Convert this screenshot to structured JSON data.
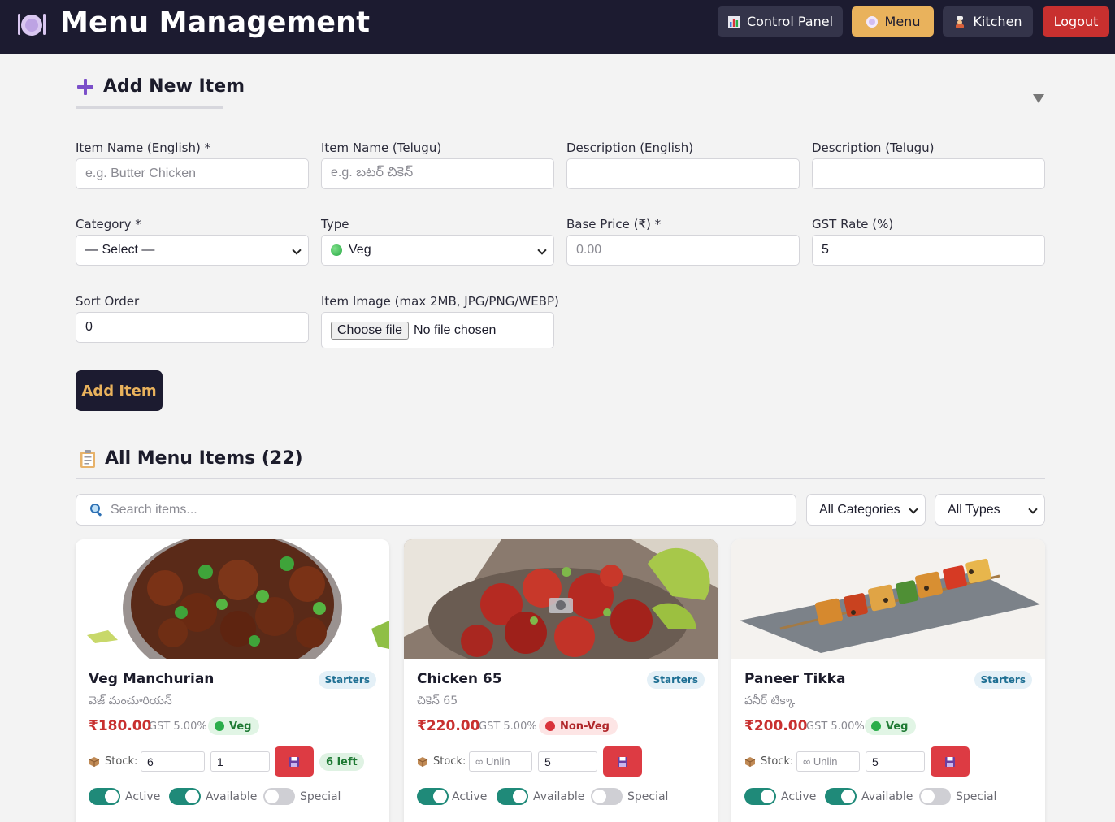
{
  "header": {
    "title": "Menu Management",
    "icon": "plate-cutlery-icon",
    "nav": {
      "control_panel": "Control Panel",
      "menu": "Menu",
      "kitchen": "Kitchen",
      "logout": "Logout"
    },
    "colors": {
      "bar": "#1c1b30",
      "active_nav": "#e9b25c",
      "logout": "#c8302f"
    }
  },
  "add_form": {
    "title": "Add New Item",
    "fields": {
      "name_en": {
        "label": "Item Name (English) *",
        "placeholder": "e.g. Butter Chicken"
      },
      "name_te": {
        "label": "Item Name (Telugu)",
        "placeholder": "e.g. బటర్ చికెన్"
      },
      "desc_en": {
        "label": "Description (English)",
        "value": ""
      },
      "desc_te": {
        "label": "Description (Telugu)",
        "value": ""
      },
      "category": {
        "label": "Category *",
        "value": "— Select —"
      },
      "type": {
        "label": "Type",
        "value": "Veg"
      },
      "base_price": {
        "label": "Base Price (₹) *",
        "placeholder": "0.00"
      },
      "gst_rate": {
        "label": "GST Rate (%)",
        "value": "5"
      },
      "sort_order": {
        "label": "Sort Order",
        "value": "0"
      },
      "image": {
        "label": "Item Image (max 2MB, JPG/PNG/WEBP)",
        "button": "Choose file",
        "status": "No file chosen"
      }
    },
    "submit": "Add Item"
  },
  "list": {
    "title": "All Menu Items (22)",
    "search_placeholder": "Search items...",
    "filter_category": "All Categories",
    "filter_type": "All Types",
    "items": [
      {
        "name": "Veg Manchurian",
        "name_te": "వెజ్ మంచూరియన్",
        "category": "Starters",
        "price": "₹180.00",
        "gst": "GST 5.00%",
        "type": "Veg",
        "stock_label": "Stock:",
        "stock_value": "6",
        "stock_step": "1",
        "stock_left": "6 left",
        "toggles": {
          "active": "Active",
          "available": "Available",
          "special": "Special"
        }
      },
      {
        "name": "Chicken 65",
        "name_te": "చికెన్ 65",
        "category": "Starters",
        "price": "₹220.00",
        "gst": "GST 5.00%",
        "type": "Non-Veg",
        "stock_label": "Stock:",
        "stock_placeholder": "∞ Unlin",
        "stock_step": "5",
        "toggles": {
          "active": "Active",
          "available": "Available",
          "special": "Special"
        }
      },
      {
        "name": "Paneer Tikka",
        "name_te": "పనీర్ టిక్కా",
        "category": "Starters",
        "price": "₹200.00",
        "gst": "GST 5.00%",
        "type": "Veg",
        "stock_label": "Stock:",
        "stock_placeholder": "∞ Unlin",
        "stock_step": "5",
        "toggles": {
          "active": "Active",
          "available": "Available",
          "special": "Special"
        }
      }
    ]
  }
}
